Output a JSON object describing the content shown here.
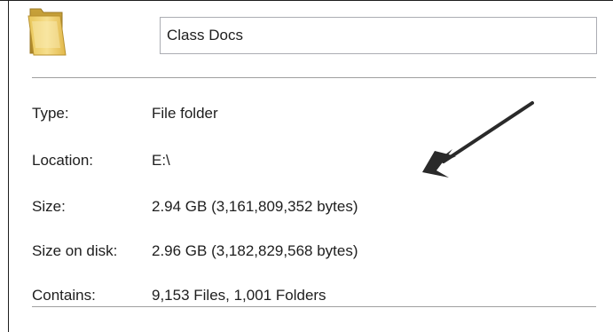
{
  "folder": {
    "icon": "folder-icon",
    "name_value": "Class Docs"
  },
  "properties": {
    "type": {
      "label": "Type:",
      "value": "File folder"
    },
    "location": {
      "label": "Location:",
      "value": "E:\\"
    },
    "size": {
      "label": "Size:",
      "value": "2.94 GB (3,161,809,352 bytes)"
    },
    "size_on_disk": {
      "label": "Size on disk:",
      "value": "2.96 GB (3,182,829,568 bytes)"
    },
    "contains": {
      "label": "Contains:",
      "value": "9,153 Files, 1,001 Folders"
    }
  },
  "annotation": {
    "icon": "arrow-icon",
    "color": "#2a2a2a"
  }
}
